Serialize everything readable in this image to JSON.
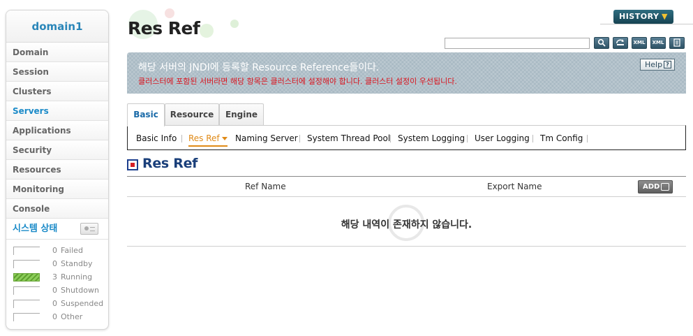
{
  "sidebar": {
    "domain": "domain1",
    "items": [
      {
        "label": "Domain"
      },
      {
        "label": "Session"
      },
      {
        "label": "Clusters"
      },
      {
        "label": "Servers"
      },
      {
        "label": "Applications"
      },
      {
        "label": "Security"
      },
      {
        "label": "Resources"
      },
      {
        "label": "Monitoring"
      },
      {
        "label": "Console"
      }
    ],
    "active_item": "Servers",
    "status_title": "시스템 상태",
    "status": [
      {
        "count": "0",
        "label": "Failed"
      },
      {
        "count": "0",
        "label": "Standby"
      },
      {
        "count": "3",
        "label": "Running"
      },
      {
        "count": "0",
        "label": "Shutdown"
      },
      {
        "count": "0",
        "label": "Suspended"
      },
      {
        "count": "0",
        "label": "Other"
      }
    ]
  },
  "header": {
    "title": "Res Ref",
    "history_label": "HISTORY",
    "search": {
      "value": "",
      "placeholder": ""
    },
    "toolbar_icons": [
      "search-icon",
      "refresh-icon",
      "xml-upload-icon",
      "xml-download-icon",
      "export-icon"
    ],
    "xml_label": "XML"
  },
  "banner": {
    "main": "해당 서버의 JNDI에 등록할 Resource Reference들이다.",
    "warning": "클러스터에 포함된 서버라면 해당 항목은 클러스터에 설정해야 합니다. 클러스터 설정이 우선됩니다.",
    "help_label": "Help",
    "help_glyph": "?"
  },
  "tabs": [
    {
      "label": "Basic"
    },
    {
      "label": "Resource"
    },
    {
      "label": "Engine"
    }
  ],
  "active_tab": "Basic",
  "subnav": [
    {
      "label": "Basic Info"
    },
    {
      "label": "Res Ref"
    },
    {
      "label": "Naming Server"
    },
    {
      "label": "System Thread Pool"
    },
    {
      "label": "System Logging"
    },
    {
      "label": "User Logging"
    },
    {
      "label": "Tm Config"
    }
  ],
  "active_subnav": "Res Ref",
  "section": {
    "title": "Res Ref",
    "columns": [
      "Ref Name",
      "Export Name"
    ],
    "add_label": "ADD",
    "empty_message": "해당 내역이 존재하지 않습니다."
  },
  "colors": {
    "accent_blue": "#1a8ac8",
    "active_orange": "#e08a17",
    "warning_red": "#d9141e",
    "banner_bg": "#a7b8c2",
    "history_bg": "#1f5566",
    "running_green": "#6aa53a"
  }
}
